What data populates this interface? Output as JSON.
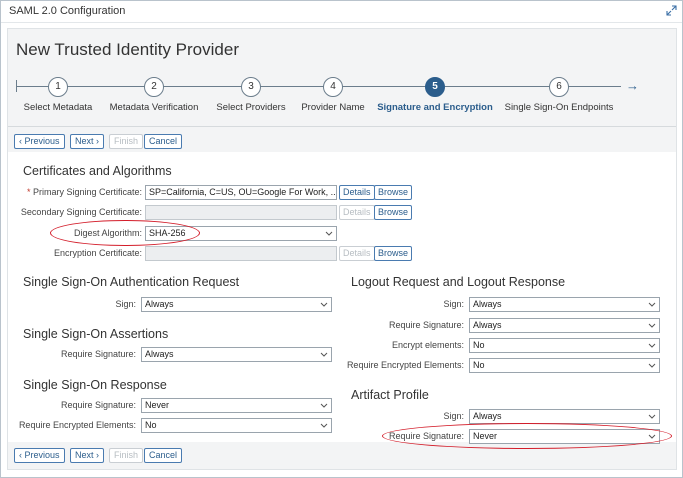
{
  "window": {
    "title": "SAML 2.0 Configuration"
  },
  "page": {
    "heading": "New Trusted Identity Provider"
  },
  "wizard": {
    "steps": [
      {
        "num": "1",
        "label": "Select Metadata"
      },
      {
        "num": "2",
        "label": "Metadata Verification"
      },
      {
        "num": "3",
        "label": "Select Providers"
      },
      {
        "num": "4",
        "label": "Provider Name"
      },
      {
        "num": "5",
        "label": "Signature and Encryption"
      },
      {
        "num": "6",
        "label": "Single Sign-On Endpoints"
      }
    ],
    "active_step": "5"
  },
  "nav": {
    "previous": "Previous",
    "next": "Next",
    "finish": "Finish",
    "cancel": "Cancel"
  },
  "certs": {
    "title": "Certificates and Algorithms",
    "primary_label": "Primary Signing Certificate:",
    "primary_value": "SP=California, C=US, OU=Google For Work, ...",
    "secondary_label": "Secondary Signing Certificate:",
    "secondary_value": "",
    "digest_label": "Digest Algorithm:",
    "digest_value": "SHA-256",
    "encryption_label": "Encryption Certificate:",
    "encryption_value": "",
    "details": "Details",
    "browse": "Browse"
  },
  "sso_auth": {
    "title": "Single Sign-On Authentication Request",
    "sign_label": "Sign:",
    "sign_value": "Always"
  },
  "sso_assert": {
    "title": "Single Sign-On Assertions",
    "req_sig_label": "Require Signature:",
    "req_sig_value": "Always"
  },
  "sso_resp": {
    "title": "Single Sign-On Response",
    "req_sig_label": "Require Signature:",
    "req_sig_value": "Never",
    "req_enc_label": "Require Encrypted Elements:",
    "req_enc_value": "No"
  },
  "logout": {
    "title": "Logout Request and Logout Response",
    "sign_label": "Sign:",
    "sign_value": "Always",
    "req_sig_label": "Require Signature:",
    "req_sig_value": "Always",
    "enc_label": "Encrypt elements:",
    "enc_value": "No",
    "req_enc_label": "Require Encrypted Elements:",
    "req_enc_value": "No"
  },
  "artifact": {
    "title": "Artifact Profile",
    "sign_label": "Sign:",
    "sign_value": "Always",
    "req_sig_label": "Require Signature:",
    "req_sig_value": "Never"
  },
  "colors": {
    "accent": "#2b5d8c",
    "highlight_ellipse": "#d31d2a"
  }
}
